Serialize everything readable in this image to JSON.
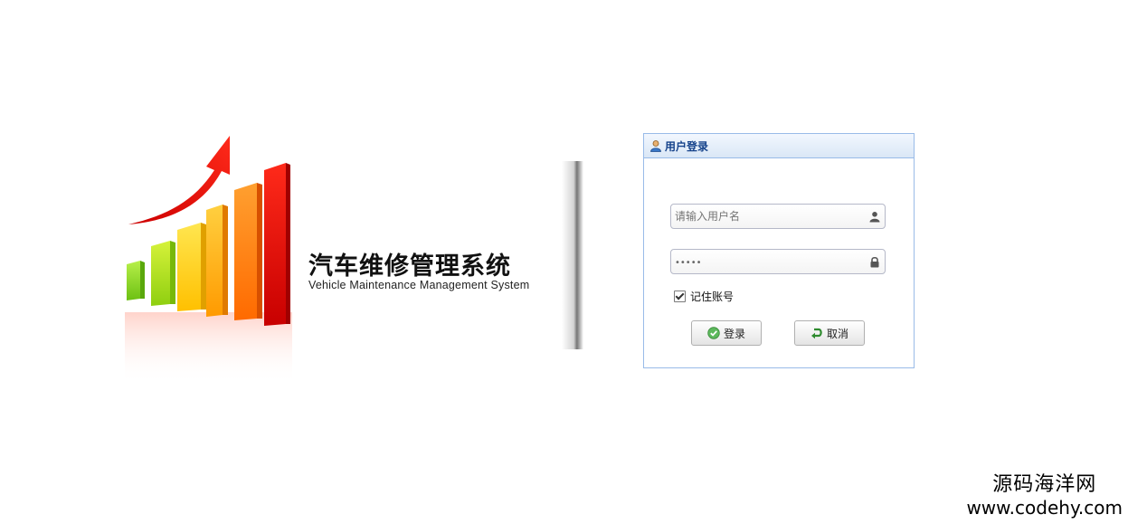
{
  "brand": {
    "title_cn": "汽车维修管理系统",
    "title_en": "Vehicle Maintenance Management System",
    "logo_icon": "bar-growth-arrow-logo"
  },
  "login": {
    "header_title": "用户登录",
    "header_icon": "user-icon",
    "username": {
      "placeholder": "请输入用户名",
      "value": "",
      "icon": "user-icon"
    },
    "password": {
      "value": "•••••",
      "icon": "lock-icon"
    },
    "remember_label": "记住账号",
    "remember_checked": true,
    "login_button": "登录",
    "cancel_button": "取消"
  },
  "watermark": {
    "line1": "源码海洋网",
    "line2": "www.codehy.com"
  },
  "colors": {
    "panel_border": "#99bbe8",
    "header_text": "#15428b"
  }
}
